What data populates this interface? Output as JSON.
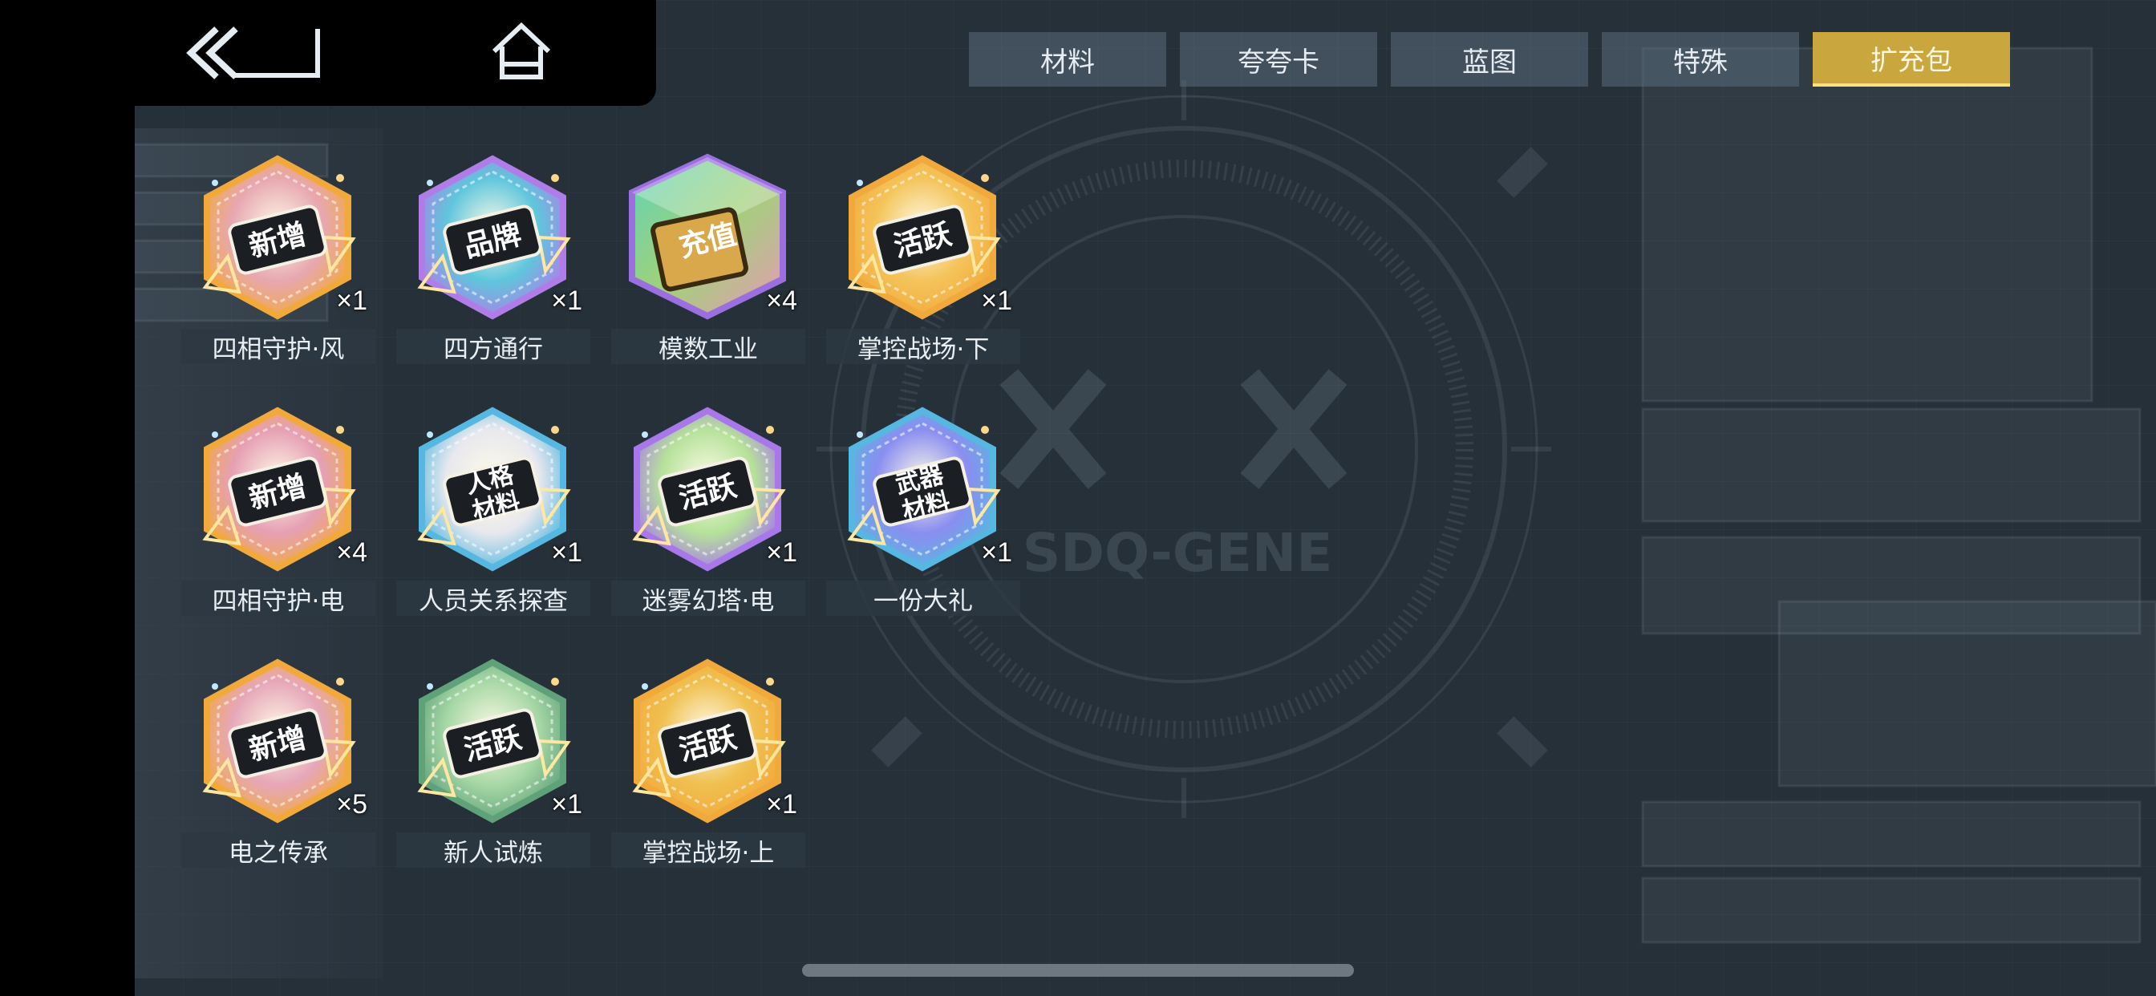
{
  "nav": {
    "back_icon": "back-icon",
    "home_icon": "home-icon"
  },
  "tabs": [
    {
      "label": "材料",
      "active": false
    },
    {
      "label": "夸夸卡",
      "active": false
    },
    {
      "label": "蓝图",
      "active": false
    },
    {
      "label": "特殊",
      "active": false
    },
    {
      "label": "扩充包",
      "active": true
    }
  ],
  "background": {
    "logo_text": "SDQ-GENE"
  },
  "items": [
    {
      "name": "四相守护·风",
      "badge": "新增",
      "count": "×1",
      "frame_color": "#f2a93b",
      "fill": "#e7a7b0",
      "icon": "hexagon-badge-icon"
    },
    {
      "name": "四方通行",
      "badge": "品牌",
      "count": "×1",
      "frame_color": "#b07de8",
      "fill": "#5fc6dc",
      "icon": "hexagon-badge-icon"
    },
    {
      "name": "模数工业",
      "badge": "充值",
      "count": "×4",
      "frame_color": "#9b6fe0",
      "fill": "#9fd27a",
      "icon": "cube-badge-icon"
    },
    {
      "name": "掌控战场·下",
      "badge": "活跃",
      "count": "×1",
      "frame_color": "#f2a93b",
      "fill": "#f4c45a",
      "icon": "hexagon-badge-icon"
    },
    {
      "name": "四相守护·电",
      "badge": "新增",
      "count": "×4",
      "frame_color": "#f2a93b",
      "fill": "#e6a0b4",
      "icon": "hexagon-badge-icon"
    },
    {
      "name": "人员关系探查",
      "badge": "人格材料",
      "count": "×1",
      "frame_color": "#56b8e0",
      "fill": "#e8e8ee",
      "icon": "hexagon-badge-icon"
    },
    {
      "name": "迷雾幻塔·电",
      "badge": "活跃",
      "count": "×1",
      "frame_color": "#a878ea",
      "fill": "#b6e29a",
      "icon": "hexagon-badge-icon"
    },
    {
      "name": "一份大礼",
      "badge": "武器材料",
      "count": "×1",
      "frame_color": "#56b8e0",
      "fill": "#8a8ef0",
      "icon": "hexagon-badge-icon"
    },
    {
      "name": "电之传承",
      "badge": "新增",
      "count": "×5",
      "frame_color": "#f2a93b",
      "fill": "#e6a7b8",
      "icon": "hexagon-badge-icon"
    },
    {
      "name": "新人试炼",
      "badge": "活跃",
      "count": "×1",
      "frame_color": "#5fa27a",
      "fill": "#a8d8a6",
      "icon": "hexagon-badge-icon"
    },
    {
      "name": "掌控战场·上",
      "badge": "活跃",
      "count": "×1",
      "frame_color": "#f2a93b",
      "fill": "#f0c050",
      "icon": "hexagon-badge-icon"
    }
  ]
}
